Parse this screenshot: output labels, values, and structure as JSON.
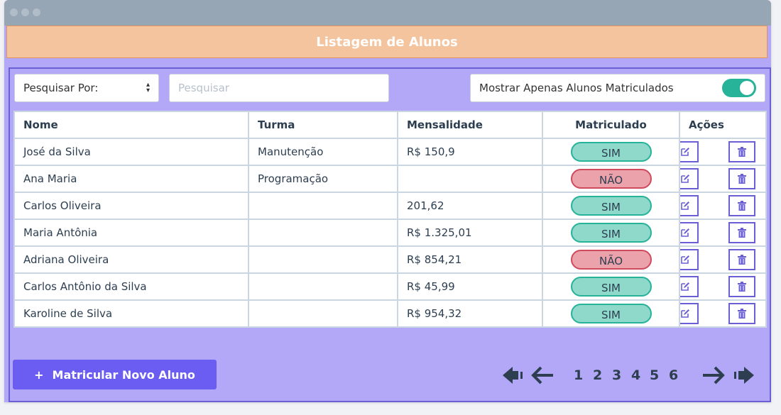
{
  "header": {
    "title": "Listagem de Alunos"
  },
  "filters": {
    "search_by_label": "Pesquisar Por:",
    "search_placeholder": "Pesquisar",
    "toggle_label": "Mostrar Apenas Alunos Matriculados",
    "toggle_on": true
  },
  "table": {
    "columns": [
      "Nome",
      "Turma",
      "Mensalidade",
      "Matriculado",
      "Ações"
    ],
    "rows": [
      {
        "nome": "José da Silva",
        "turma": "Manutenção",
        "mensalidade": "R$ 150,9",
        "matriculado": "SIM"
      },
      {
        "nome": "Ana Maria",
        "turma": "Programação",
        "mensalidade": "",
        "matriculado": "NÃO"
      },
      {
        "nome": "Carlos Oliveira",
        "turma": "",
        "mensalidade": "201,62",
        "matriculado": "SIM"
      },
      {
        "nome": "Maria Antônia",
        "turma": "",
        "mensalidade": "R$ 1.325,01",
        "matriculado": "SIM"
      },
      {
        "nome": "Adriana Oliveira",
        "turma": "",
        "mensalidade": "R$ 854,21",
        "matriculado": "NÃO"
      },
      {
        "nome": "Carlos Antônio da Silva",
        "turma": "",
        "mensalidade": "R$ 45,99",
        "matriculado": "SIM"
      },
      {
        "nome": "Karoline de Silva",
        "turma": "",
        "mensalidade": "R$ 954,32",
        "matriculado": "SIM"
      }
    ]
  },
  "actions": {
    "add_label": "Matricular Novo Aluno",
    "add_icon": "+"
  },
  "pagination": {
    "pages": [
      "1",
      "2",
      "3",
      "4",
      "5",
      "6"
    ],
    "icons": [
      "first-page-icon",
      "prev-page-icon",
      "next-page-icon",
      "last-page-icon"
    ]
  },
  "icons": {
    "edit": "edit-icon",
    "delete": "trash-icon"
  },
  "colors": {
    "panel": "#b2a8f7",
    "header": "#f4c49f",
    "accent": "#6b5cf2",
    "sim": "#8fd9cb",
    "nao": "#eba2ab",
    "toggle": "#26b39a"
  }
}
